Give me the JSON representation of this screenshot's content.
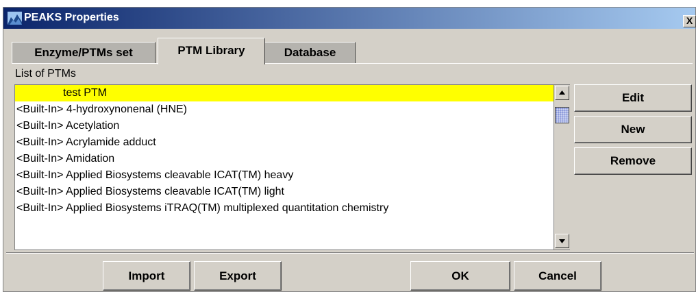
{
  "window": {
    "title": "PEAKS Properties",
    "close_label": "X"
  },
  "tabs": [
    {
      "label": "Enzyme/PTMs set",
      "active": false
    },
    {
      "label": "PTM Library",
      "active": true
    },
    {
      "label": "Database",
      "active": false
    }
  ],
  "list": {
    "label": "List of PTMs",
    "items": [
      "test PTM",
      "<Built-In> 4-hydroxynonenal (HNE)",
      "<Built-In> Acetylation",
      "<Built-In> Acrylamide adduct",
      "<Built-In> Amidation",
      "<Built-In> Applied Biosystems cleavable ICAT(TM) heavy",
      "<Built-In> Applied Biosystems cleavable ICAT(TM) light",
      "<Built-In> Applied Biosystems iTRAQ(TM) multiplexed quantitation chemistry"
    ],
    "selected_index": 0
  },
  "side_buttons": {
    "edit": "Edit",
    "new": "New",
    "remove": "Remove"
  },
  "bottom_buttons": {
    "import": "Import",
    "export": "Export",
    "ok": "OK",
    "cancel": "Cancel"
  },
  "colors": {
    "selection": "#ffff00",
    "titlebar_start": "#0a246a",
    "titlebar_end": "#a6caf0",
    "panel": "#d4d0c8"
  },
  "icons": {
    "app": "peaks-mountain-icon",
    "close": "close-icon",
    "scroll_up": "arrow-up-icon",
    "scroll_down": "arrow-down-icon"
  }
}
